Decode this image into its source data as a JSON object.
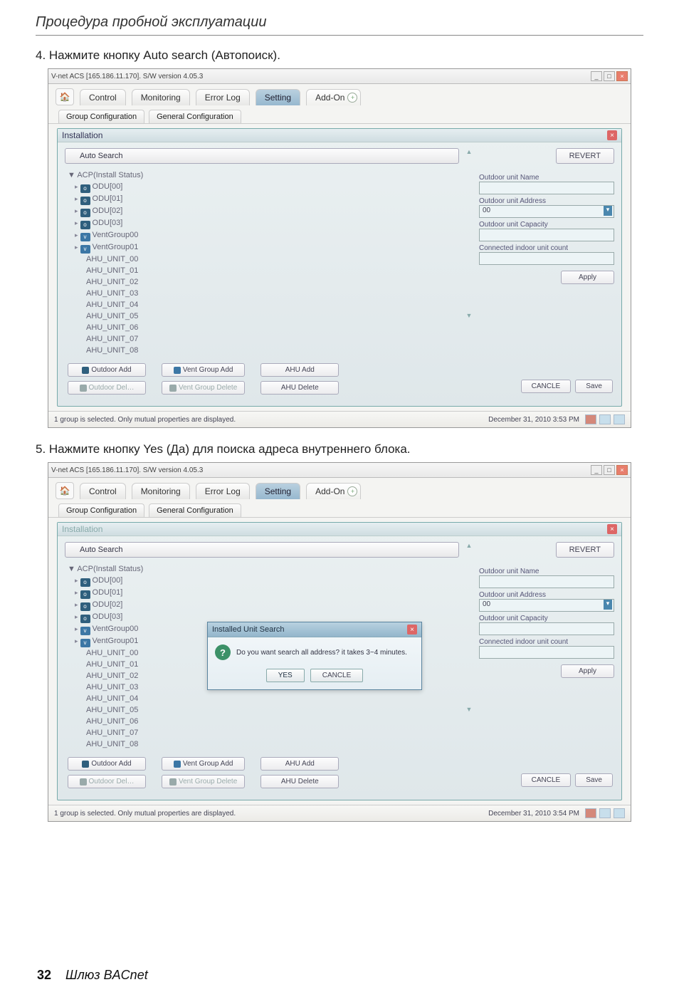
{
  "doc": {
    "section_header": "Процедура пробной эксплуатации",
    "step4": "4. Нажмите кнопку Auto search (Автопоиск).",
    "step5": "5. Нажмите кнопку Yes (Да) для поиска адреса внутреннего блока.",
    "footer_page": "32",
    "footer_title": "Шлюз BACnet"
  },
  "win_a": {
    "title": "V-net ACS [165.186.11.170].   S/W version 4.05.3",
    "tabs": {
      "home": "Home",
      "control": "Control",
      "monitoring": "Monitoring",
      "error_log": "Error Log",
      "setting": "Setting",
      "add_on": "Add-On"
    },
    "sub_tabs": {
      "group": "Group Configuration",
      "general": "General Configuration"
    },
    "panel_title": "Installation",
    "auto_search": "Auto Search",
    "revert": "REVERT",
    "tree_root": "▼ ACP(Install Status)",
    "odu": [
      "ODU[00]",
      "ODU[01]",
      "ODU[02]",
      "ODU[03]"
    ],
    "vent_groups": [
      "VentGroup00",
      "VentGroup01"
    ],
    "ahu_units": [
      "AHU_UNIT_00",
      "AHU_UNIT_01",
      "AHU_UNIT_02",
      "AHU_UNIT_03",
      "AHU_UNIT_04",
      "AHU_UNIT_05",
      "AHU_UNIT_06",
      "AHU_UNIT_07",
      "AHU_UNIT_08"
    ],
    "form": {
      "lbl_name": "Outdoor unit Name",
      "lbl_addr": "Outdoor unit Address",
      "addr_val": "00",
      "lbl_cap": "Outdoor unit Capacity",
      "lbl_count": "Connected indoor unit count",
      "apply": "Apply",
      "cancel": "CANCLE",
      "save": "Save"
    },
    "btn_row": {
      "outdoor_add": "Outdoor Add",
      "outdoor_del": "Outdoor Del…",
      "vent_add": "Vent Group Add",
      "vent_del": "Vent Group Delete",
      "ahu_add": "AHU Add",
      "ahu_del": "AHU Delete"
    },
    "status_left": "1 group is selected. Only mutual properties are displayed.",
    "status_date": "December 31, 2010  3:53 PM"
  },
  "win_b": {
    "status_date": "December 31, 2010  3:54 PM",
    "dialog": {
      "title": "Installed Unit Search",
      "body": "Do you want search all address? it takes 3~4 minutes.",
      "yes": "YES",
      "cancel": "CANCLE"
    }
  }
}
